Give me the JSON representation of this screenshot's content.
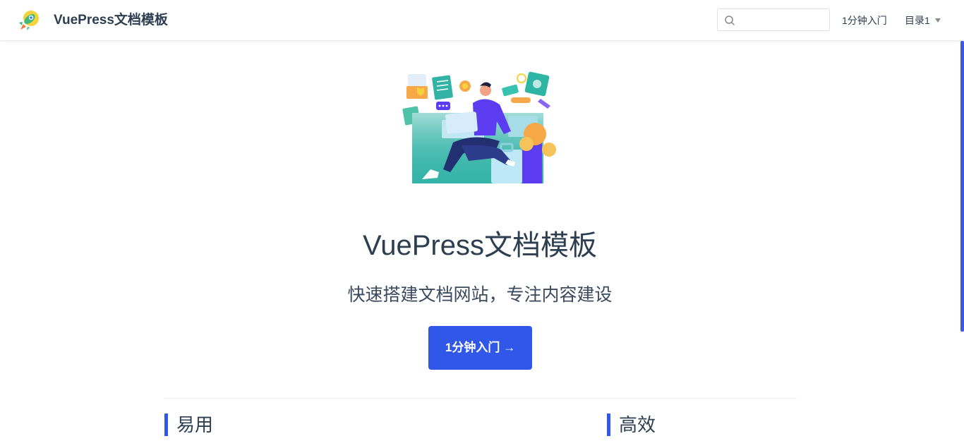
{
  "navbar": {
    "site_name": "VuePress文档模板",
    "logo_icon": "rocket-icon",
    "search": {
      "value": "",
      "placeholder": ""
    },
    "links": [
      {
        "label": "1分钟入门"
      },
      {
        "label": "目录1",
        "has_dropdown": true
      }
    ]
  },
  "hero": {
    "illustration": "person-with-laptop-illustration",
    "title": "VuePress文档模板",
    "description": "快速搭建文档网站，专注内容建设",
    "action_label": "1分钟入门 →"
  },
  "features": [
    {
      "title": "易用"
    },
    {
      "title": "高效"
    }
  ],
  "colors": {
    "accent": "#3157e8",
    "text": "#2c3e50",
    "border": "#eaecef"
  }
}
